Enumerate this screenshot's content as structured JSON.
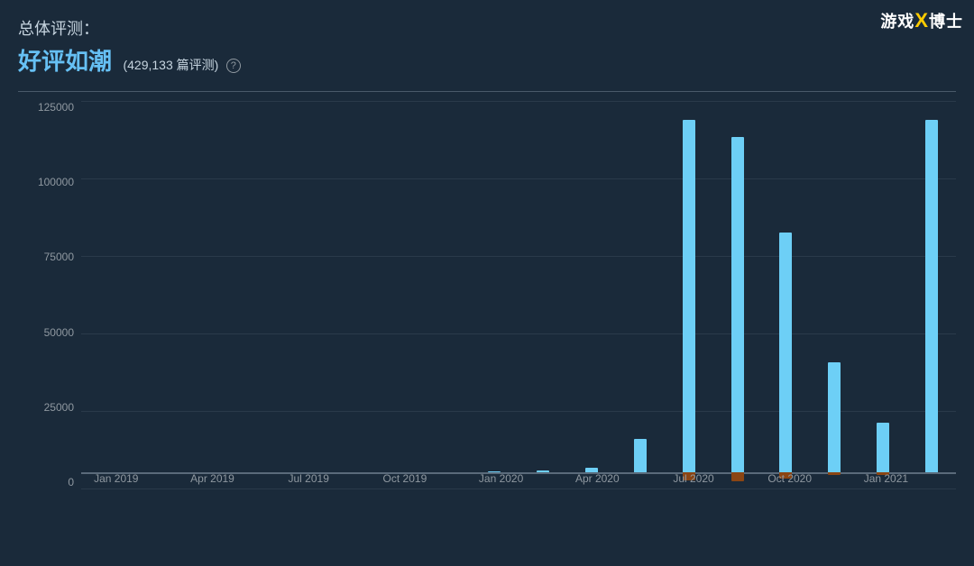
{
  "logo": {
    "part1": "游戏",
    "part2": "X",
    "part3": "博士"
  },
  "header": {
    "overall_label": "总体评测：",
    "rating": "好评如潮",
    "count_text": "(429,133 篇评测)",
    "help": "?"
  },
  "chart": {
    "y_labels": [
      "125000",
      "100000",
      "75000",
      "50000",
      "25000",
      "0"
    ],
    "x_labels": [
      {
        "text": "Jan 2019",
        "pct": 4
      },
      {
        "text": "Apr 2019",
        "pct": 15
      },
      {
        "text": "Jul 2019",
        "pct": 26
      },
      {
        "text": "Oct 2019",
        "pct": 37
      },
      {
        "text": "Jan 2020",
        "pct": 48
      },
      {
        "text": "Apr 2020",
        "pct": 59
      },
      {
        "text": "Jul 2020",
        "pct": 70
      },
      {
        "text": "Oct 2020",
        "pct": 81
      },
      {
        "text": "Jan 2021",
        "pct": 92
      }
    ],
    "max_value": 130000,
    "zero_pct": 100,
    "bars": [
      {
        "pos": 0,
        "neg": 0
      },
      {
        "pos": 0,
        "neg": 0
      },
      {
        "pos": 0,
        "neg": 0
      },
      {
        "pos": 0,
        "neg": 0
      },
      {
        "pos": 0,
        "neg": 0
      },
      {
        "pos": 0,
        "neg": 0
      },
      {
        "pos": 0,
        "neg": 0
      },
      {
        "pos": 0,
        "neg": 0
      },
      {
        "pos": 200,
        "neg": 0
      },
      {
        "pos": 500,
        "neg": 0
      },
      {
        "pos": 1500,
        "neg": 0
      },
      {
        "pos": 12000,
        "neg": 0
      },
      {
        "pos": 128000,
        "neg": 3000
      },
      {
        "pos": 122000,
        "neg": 3500
      },
      {
        "pos": 87000,
        "neg": 2500
      },
      {
        "pos": 40000,
        "neg": 1200
      },
      {
        "pos": 18000,
        "neg": 1000
      },
      {
        "pos": 128000,
        "neg": 0
      }
    ]
  }
}
